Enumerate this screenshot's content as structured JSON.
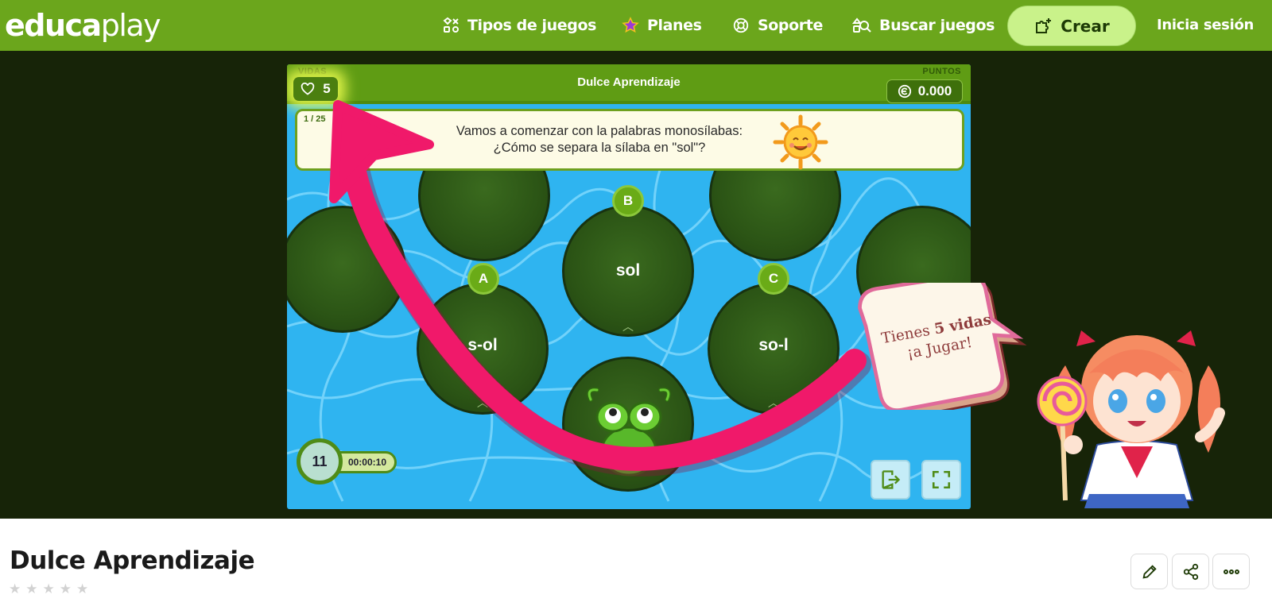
{
  "brand": {
    "logo_bold": "educa",
    "logo_light": "play"
  },
  "nav": {
    "items": [
      {
        "label": "Tipos de juegos",
        "icon": "shapes-icon"
      },
      {
        "label": "Planes",
        "icon": "star-icon"
      },
      {
        "label": "Soporte",
        "icon": "lifebuoy-icon"
      },
      {
        "label": "Buscar juegos",
        "icon": "search-shapes-icon"
      }
    ],
    "create_label": "Crear",
    "login_label": "Inicia sesión"
  },
  "game": {
    "lives_label": "VIDAS",
    "lives": "5",
    "title": "Dulce Aprendizaje",
    "points_label": "PUNTOS",
    "points": "0.000",
    "question_counter": "1 / 25",
    "question_line1": "Vamos a comenzar con la palabras monosílabas:",
    "question_line2": "¿Cómo se separa la sílaba en \"sol\"?",
    "options": [
      {
        "letter": "A",
        "text": "s-ol"
      },
      {
        "letter": "B",
        "text": "sol"
      },
      {
        "letter": "C",
        "text": "so-l"
      }
    ],
    "timer_count": "11",
    "timer_elapsed": "00:00:10",
    "bubble_pre": "Tienes ",
    "bubble_bold": "5 vidas",
    "bubble_line2": "¡a Jugar!"
  },
  "colors": {
    "brand_green": "#6ba61c",
    "create_bg": "#c9f28a",
    "stage_bg": "#172408",
    "arrow": "#f0196a",
    "water": "#2fb4f0"
  },
  "page": {
    "title": "Dulce Aprendizaje",
    "rating_stars": 5,
    "rating_value": 0,
    "actions": [
      {
        "icon": "pencil-icon"
      },
      {
        "icon": "share-icon"
      },
      {
        "icon": "more-icon"
      }
    ]
  }
}
